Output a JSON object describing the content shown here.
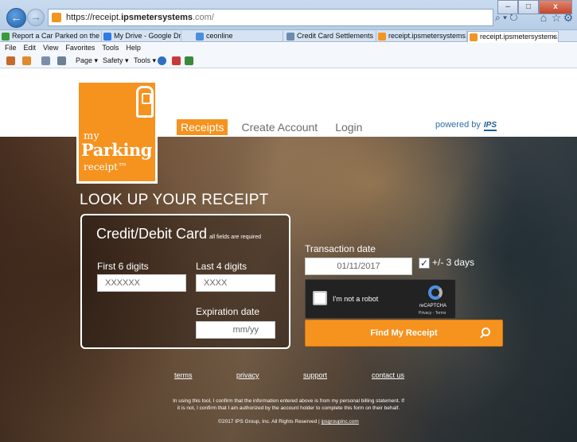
{
  "browser": {
    "url_host": "https://receipt.",
    "url_bold": "ipsmetersystems",
    "url_rest": ".com/",
    "tabs": [
      {
        "label": "Report a Car Parked on the ...",
        "color": "#3a9a3a"
      },
      {
        "label": "My Drive - Google Drive",
        "color": "#2f7be5"
      },
      {
        "label": "ceonline",
        "color": "#4a90d9"
      },
      {
        "label": "Credit Card Settlements - D...",
        "color": "#6a8ab0"
      },
      {
        "label": "receipt.ipsmetersystems.co...",
        "color": "#f39621"
      },
      {
        "label": "receipt.ipsmetersystems...",
        "color": "#f39621"
      }
    ],
    "tab_close": "×",
    "menu": [
      "File",
      "Edit",
      "View",
      "Favorites",
      "Tools",
      "Help"
    ],
    "commands": [
      "Page ▾",
      "Safety ▾",
      "Tools ▾"
    ],
    "search_glyph": "⌕ ▾ ↻",
    "window_buttons": {
      "minimize": "–",
      "maximize": "□",
      "close": "x"
    }
  },
  "logo": {
    "my": "my",
    "parking": "Parking",
    "receipt": "receipt™"
  },
  "nav": {
    "receipts": "Receipts",
    "create_account": "Create Account",
    "login": "Login"
  },
  "powered": {
    "text": "powered by",
    "brand": "IPS"
  },
  "lookup_title": "LOOK UP YOUR RECEIPT",
  "card": {
    "title": "Credit/Debit Card",
    "note": "all fields are required",
    "first6_label": "First 6 digits",
    "first6_placeholder": "XXXXXX",
    "last4_label": "Last 4 digits",
    "last4_placeholder": "XXXX",
    "expiration_label": "Expiration date",
    "expiration_placeholder": "mm/yy"
  },
  "transaction": {
    "label": "Transaction date",
    "value": "01/11/2017",
    "days_checked": true,
    "days_label": "+/- 3 days"
  },
  "captcha": {
    "text": "I'm not a robot",
    "brand": "reCAPTCHA",
    "terms": "Privacy - Terms"
  },
  "find_button": "Find My Receipt",
  "footer": {
    "links": [
      "terms",
      "privacy",
      "support",
      "contact us"
    ],
    "legal_line1": "In using this tool, I confirm that the information entered above is from my personal billing statement. If",
    "legal_line2": "it is not, I confirm that I am authorized by the account holder to complete this form on their behalf.",
    "copyright": "©2017 IPS Group, Inc. All Rights Reserved |",
    "copyright_link": "ipsgroupinc.com"
  }
}
